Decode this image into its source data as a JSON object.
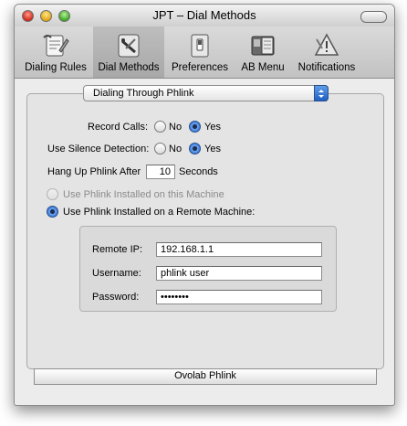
{
  "window": {
    "title": "JPT – Dial Methods"
  },
  "toolbar": {
    "items": [
      {
        "label": "Dialing Rules",
        "icon": "dialing-rules-icon",
        "selected": false
      },
      {
        "label": "Dial Methods",
        "icon": "dial-methods-icon",
        "selected": true
      },
      {
        "label": "Preferences",
        "icon": "preferences-icon",
        "selected": false
      },
      {
        "label": "AB Menu",
        "icon": "ab-menu-icon",
        "selected": false
      },
      {
        "label": "Notifications",
        "icon": "notifications-icon",
        "selected": false
      }
    ]
  },
  "method_popup": {
    "value": "Dialing Through Phlink"
  },
  "record_calls": {
    "label": "Record Calls:",
    "no": "No",
    "yes": "Yes",
    "selected": "Yes"
  },
  "silence_detection": {
    "label": "Use Silence Detection:",
    "no": "No",
    "yes": "Yes",
    "selected": "Yes"
  },
  "hang_up": {
    "label": "Hang Up Phlink After",
    "value": "10",
    "unit": "Seconds"
  },
  "install_option": {
    "local": "Use Phlink Installed on this Machine",
    "remote": "Use Phlink Installed on a Remote Machine:",
    "selected": "remote",
    "local_enabled": false
  },
  "remote": {
    "ip_label": "Remote IP:",
    "ip_value": "192.168.1.1",
    "username_label": "Username:",
    "username_value": "phlink user",
    "password_label": "Password:",
    "password_value": "••••••••"
  },
  "bottom_button": {
    "label": "Ovolab Phlink"
  },
  "colors": {
    "accent": "#2b6ad6",
    "window_bg": "#ececec"
  }
}
